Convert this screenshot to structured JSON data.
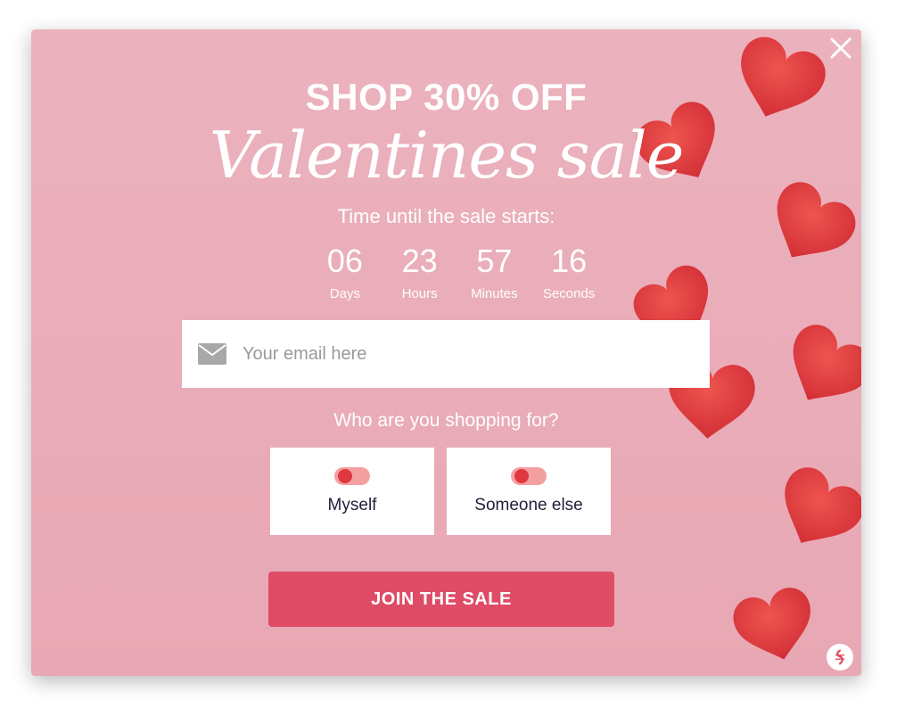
{
  "popup": {
    "headline": "SHOP 30% OFF",
    "script_title": "Valentines sale",
    "subtitle": "Time until the sale starts:",
    "countdown": [
      {
        "value": "06",
        "label": "Days"
      },
      {
        "value": "23",
        "label": "Hours"
      },
      {
        "value": "57",
        "label": "Minutes"
      },
      {
        "value": "16",
        "label": "Seconds"
      }
    ],
    "email": {
      "placeholder": "Your email here",
      "icon": "mail-icon"
    },
    "question": "Who are you shopping for?",
    "choices": [
      {
        "label": "Myself",
        "icon": "toggle"
      },
      {
        "label": "Someone else",
        "icon": "toggle"
      }
    ],
    "cta_label": "JOIN THE SALE",
    "close_icon": "close-icon",
    "badge_icon": "brand-badge-icon"
  },
  "colors": {
    "background": "#e8a7b4",
    "heart": "#e23b42",
    "cta": "#de4c66",
    "toggle_track": "#f4a0a3",
    "toggle_knob": "#e0383f"
  }
}
